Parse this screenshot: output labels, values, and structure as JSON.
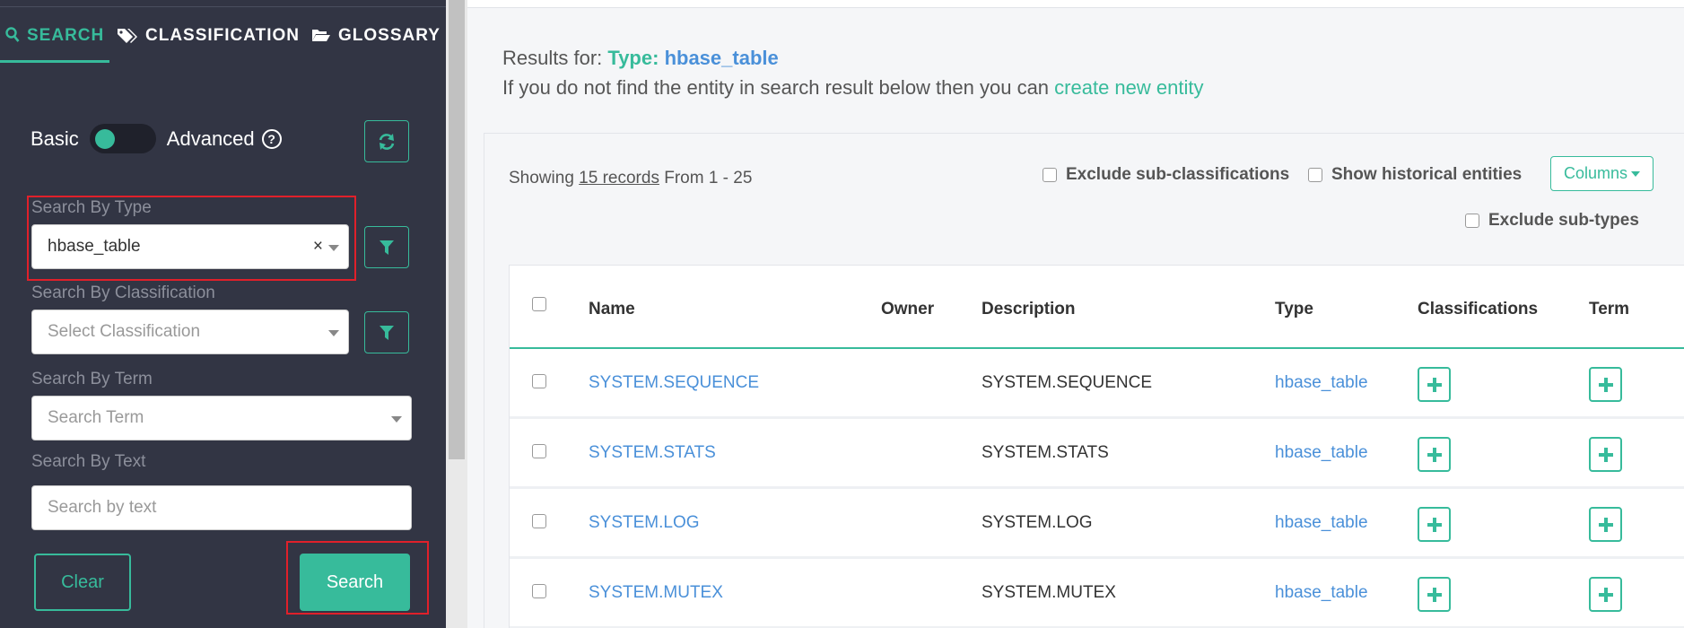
{
  "sidebar": {
    "tabs": [
      {
        "label": "SEARCH",
        "icon": "search-icon"
      },
      {
        "label": "CLASSIFICATION",
        "icon": "tags-icon"
      },
      {
        "label": "GLOSSARY",
        "icon": "folder-open-icon"
      }
    ],
    "toggle": {
      "basic_label": "Basic",
      "advanced_label": "Advanced",
      "help": "?"
    },
    "type_field": {
      "label": "Search By Type",
      "value": "hbase_table",
      "clear": "×"
    },
    "classification_field": {
      "label": "Search By Classification",
      "placeholder": "Select Classification"
    },
    "term_field": {
      "label": "Search By Term",
      "placeholder": "Search Term"
    },
    "text_field": {
      "label": "Search By Text",
      "placeholder": "Search by text"
    },
    "clear_label": "Clear",
    "search_label": "Search"
  },
  "main": {
    "results_prefix": "Results for:",
    "results_type_label": "Type:",
    "results_type_value": "hbase_table",
    "hint_prefix": "If you do not find the entity in search result below then you can",
    "hint_link": "create new entity",
    "showing_prefix": "Showing",
    "showing_records": "15 records",
    "showing_range": "From 1 - 25",
    "options": {
      "exclude_sub_classifications": "Exclude sub-classifications",
      "show_historical": "Show historical entities",
      "exclude_sub_types": "Exclude sub-types"
    },
    "columns_label": "Columns"
  },
  "table": {
    "headers": [
      "Name",
      "Owner",
      "Description",
      "Type",
      "Classifications",
      "Term"
    ],
    "rows": [
      {
        "name": "SYSTEM.SEQUENCE",
        "owner": "",
        "description": "SYSTEM.SEQUENCE",
        "type": "hbase_table"
      },
      {
        "name": "SYSTEM.STATS",
        "owner": "",
        "description": "SYSTEM.STATS",
        "type": "hbase_table"
      },
      {
        "name": "SYSTEM.LOG",
        "owner": "",
        "description": "SYSTEM.LOG",
        "type": "hbase_table"
      },
      {
        "name": "SYSTEM.MUTEX",
        "owner": "",
        "description": "SYSTEM.MUTEX",
        "type": "hbase_table"
      }
    ]
  },
  "colors": {
    "accent": "#37bb9b",
    "link": "#4a90d9",
    "sidebar_bg": "#323544",
    "highlight": "#e0202a"
  }
}
